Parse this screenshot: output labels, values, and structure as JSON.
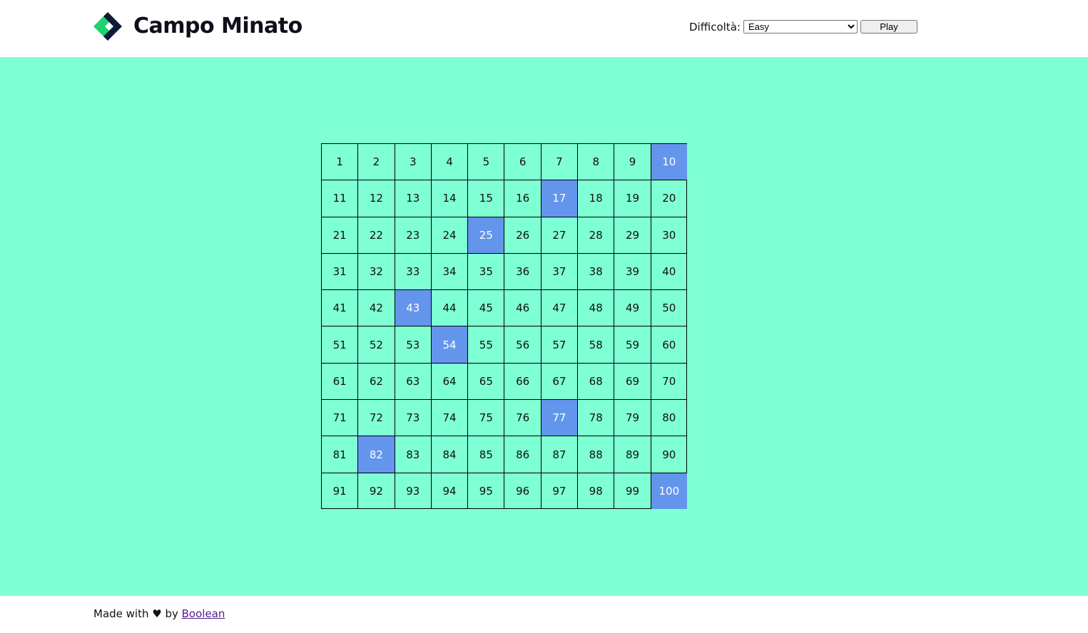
{
  "header": {
    "title": "Campo Minato",
    "difficulty_label": "Difficoltà:",
    "difficulty_selected": "Easy",
    "play_label": "Play"
  },
  "colors": {
    "board_background": "#7fffd4",
    "clicked_cell": "#6495ed",
    "logo_green": "#1ed36f",
    "logo_navy": "#0e1a3a"
  },
  "board": {
    "columns": 10,
    "rows": 10,
    "cells": [
      "1",
      "2",
      "3",
      "4",
      "5",
      "6",
      "7",
      "8",
      "9",
      "10",
      "11",
      "12",
      "13",
      "14",
      "15",
      "16",
      "17",
      "18",
      "19",
      "20",
      "21",
      "22",
      "23",
      "24",
      "25",
      "26",
      "27",
      "28",
      "29",
      "30",
      "31",
      "32",
      "33",
      "34",
      "35",
      "36",
      "37",
      "38",
      "39",
      "40",
      "41",
      "42",
      "43",
      "44",
      "45",
      "46",
      "47",
      "48",
      "49",
      "50",
      "51",
      "52",
      "53",
      "54",
      "55",
      "56",
      "57",
      "58",
      "59",
      "60",
      "61",
      "62",
      "63",
      "64",
      "65",
      "66",
      "67",
      "68",
      "69",
      "70",
      "71",
      "72",
      "73",
      "74",
      "75",
      "76",
      "77",
      "78",
      "79",
      "80",
      "81",
      "82",
      "83",
      "84",
      "85",
      "86",
      "87",
      "88",
      "89",
      "90",
      "91",
      "92",
      "93",
      "94",
      "95",
      "96",
      "97",
      "98",
      "99",
      "100"
    ],
    "clicked_cells": [
      "10",
      "17",
      "25",
      "43",
      "54",
      "77",
      "82",
      "100"
    ]
  },
  "footer": {
    "text_before": "Made with ♥ by",
    "link_label": "Boolean"
  }
}
